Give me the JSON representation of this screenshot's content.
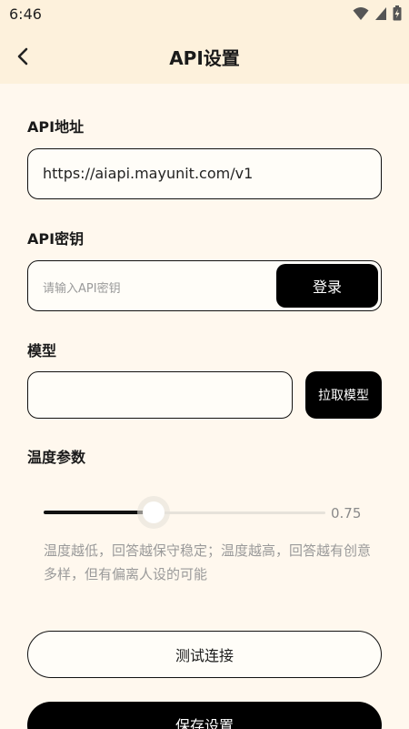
{
  "status_bar": {
    "time": "6:46"
  },
  "header": {
    "title": "API设置"
  },
  "api_address": {
    "label": "API地址",
    "value": "https://aiapi.mayunit.com/v1"
  },
  "api_key": {
    "label": "API密钥",
    "placeholder": "请输入API密钥",
    "login_label": "登录"
  },
  "model": {
    "label": "模型",
    "value": "",
    "fetch_label": "拉取模型"
  },
  "temperature": {
    "label": "温度参数",
    "value": "0.75",
    "fraction": 0.39,
    "hint": "温度越低，回答越保守稳定；温度越高，回答越有创意多样，但有偏离人设的可能"
  },
  "actions": {
    "test_label": "测试连接",
    "save_label": "保存设置"
  },
  "colors": {
    "background": "#fff8ee",
    "header_background": "#fdf1dc",
    "accent": "#000000",
    "hint_text": "#9a9a9a"
  }
}
